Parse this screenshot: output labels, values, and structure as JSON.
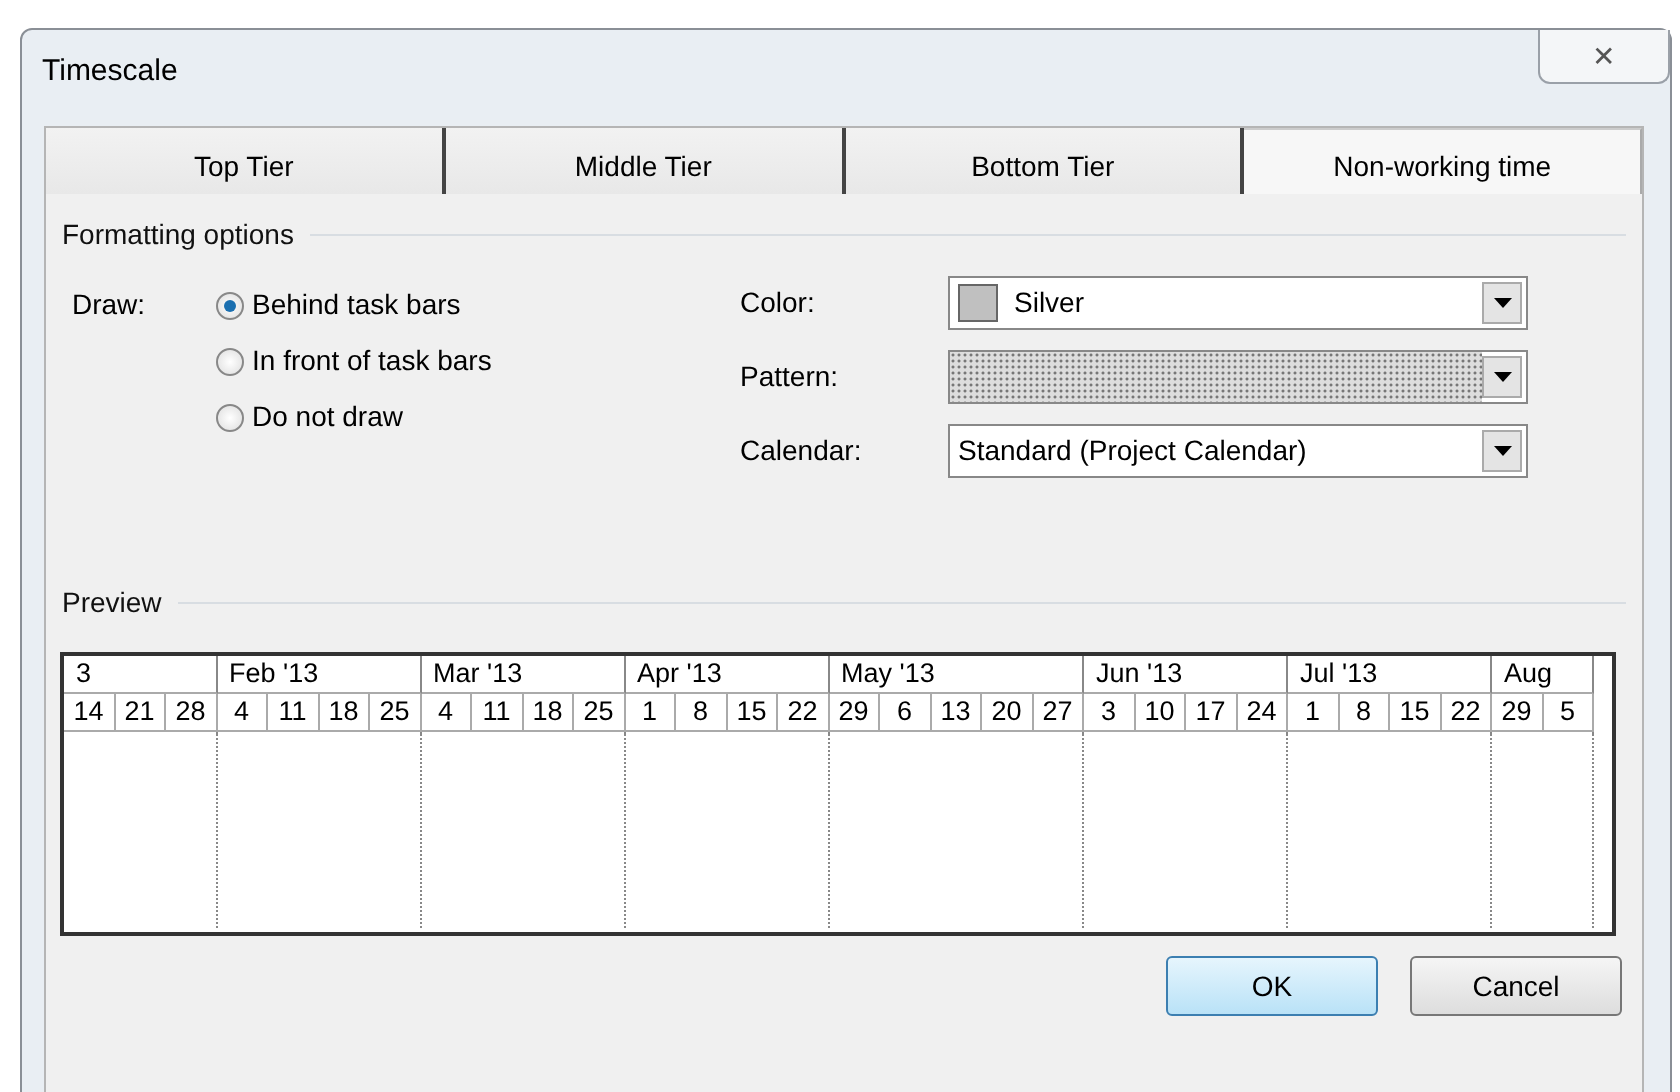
{
  "window": {
    "title": "Timescale",
    "close": "✕"
  },
  "tabs": [
    {
      "label": "Top Tier",
      "selected": false
    },
    {
      "label": "Middle Tier",
      "selected": false
    },
    {
      "label": "Bottom Tier",
      "selected": false
    },
    {
      "label": "Non-working time",
      "selected": true
    }
  ],
  "formatting": {
    "title": "Formatting options",
    "draw_label": "Draw:",
    "draw_options": [
      {
        "label": "Behind task bars",
        "selected": true
      },
      {
        "label": "In front of task bars",
        "selected": false
      },
      {
        "label": "Do not draw",
        "selected": false
      }
    ],
    "color": {
      "label": "Color:",
      "value": "Silver",
      "color": "#c0c0c0"
    },
    "pattern": {
      "label": "Pattern:",
      "kind": "dotted"
    },
    "calendar": {
      "label": "Calendar:",
      "value": "Standard (Project Calendar)"
    }
  },
  "preview": {
    "title": "Preview",
    "months": [
      {
        "label": "3",
        "weeks": [
          "14",
          "21",
          "28"
        ]
      },
      {
        "label": "Feb '13",
        "weeks": [
          "4",
          "11",
          "18",
          "25"
        ]
      },
      {
        "label": "Mar '13",
        "weeks": [
          "4",
          "11",
          "18",
          "25"
        ]
      },
      {
        "label": "Apr '13",
        "weeks": [
          "1",
          "8",
          "15",
          "22"
        ]
      },
      {
        "label": "May '13",
        "weeks": [
          "29",
          "6",
          "13",
          "20",
          "27"
        ]
      },
      {
        "label": "Jun '13",
        "weeks": [
          "3",
          "10",
          "17",
          "24"
        ]
      },
      {
        "label": "Jul '13",
        "weeks": [
          "1",
          "8",
          "15",
          "22"
        ]
      },
      {
        "label": "Aug",
        "weeks": [
          "29",
          "5"
        ]
      }
    ]
  },
  "buttons": [
    {
      "label": "OK",
      "default": true
    },
    {
      "label": "Cancel",
      "default": false
    }
  ]
}
